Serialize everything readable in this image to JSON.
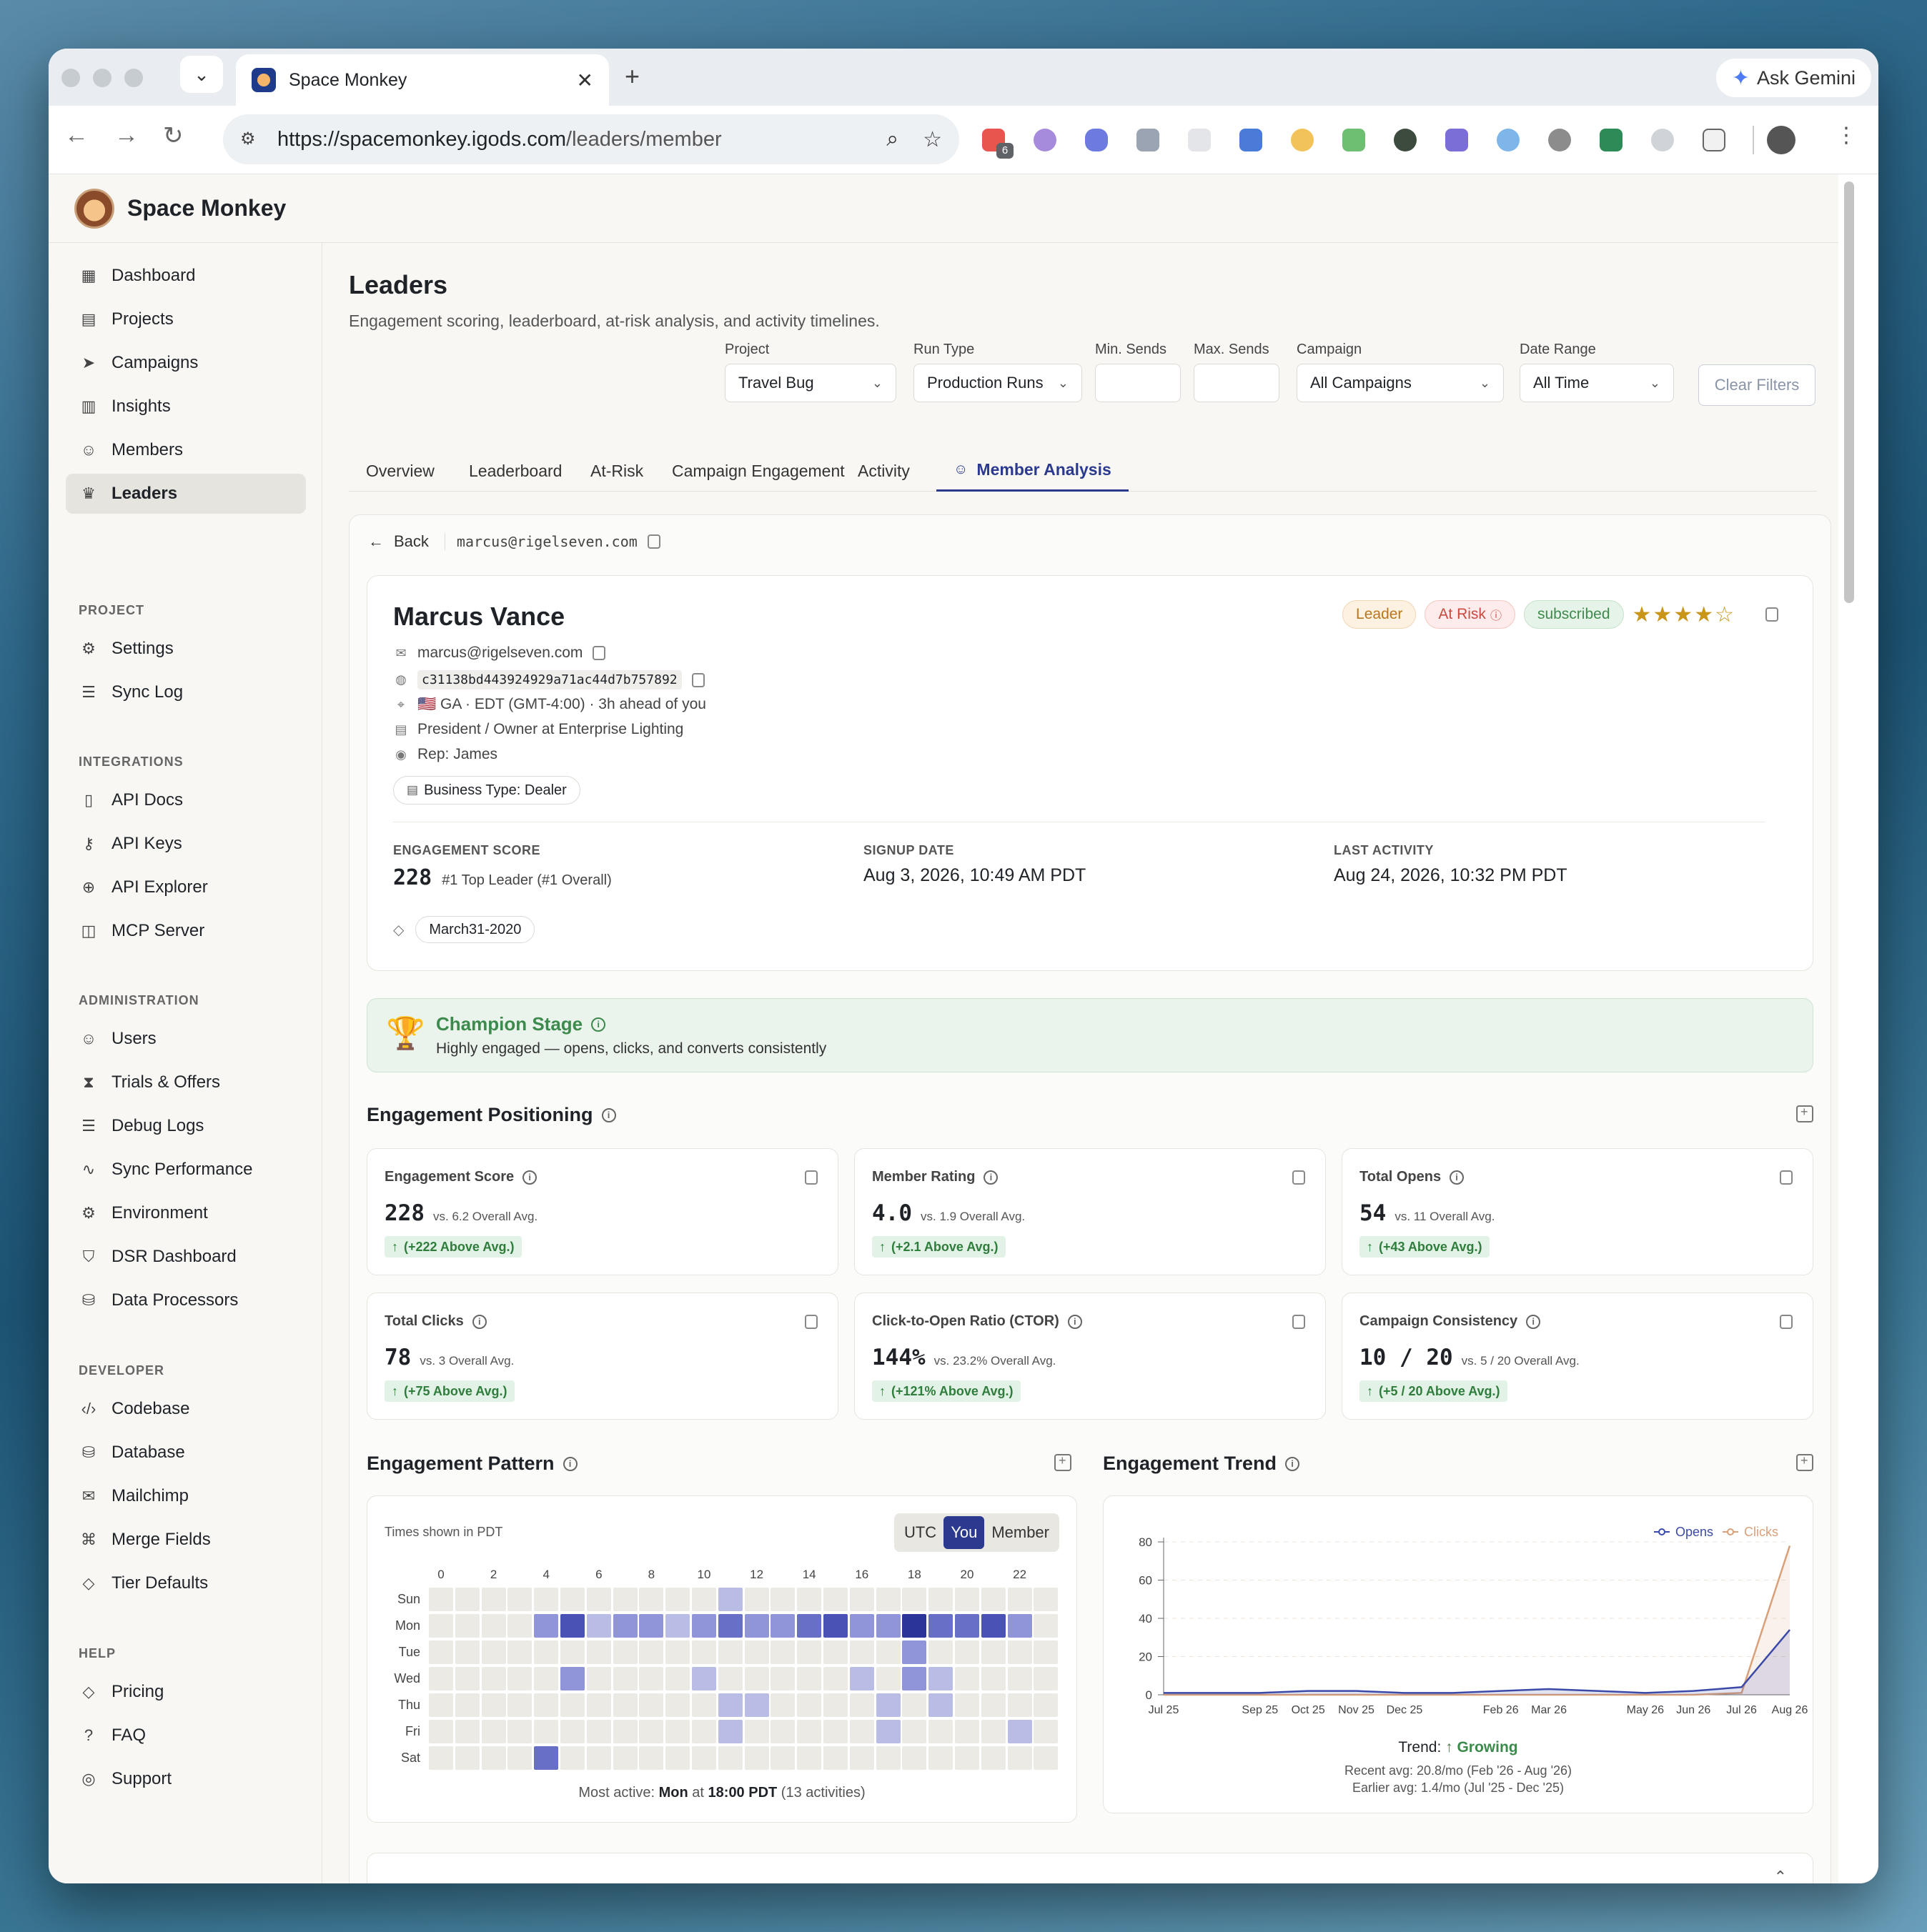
{
  "browser": {
    "tab_title": "Space Monkey",
    "url_host": "https://spacemonkey.igods.com",
    "url_path": "/leaders/member",
    "ask_gemini": "Ask Gemini",
    "ext_badge": "6"
  },
  "app": {
    "brand": "Space Monkey",
    "sidebar": {
      "main": [
        {
          "label": "Dashboard",
          "icon": "grid-icon"
        },
        {
          "label": "Projects",
          "icon": "building-icon"
        },
        {
          "label": "Campaigns",
          "icon": "send-icon"
        },
        {
          "label": "Insights",
          "icon": "bar-chart-icon"
        },
        {
          "label": "Members",
          "icon": "users-icon"
        },
        {
          "label": "Leaders",
          "icon": "crown-icon"
        }
      ],
      "project_title": "PROJECT",
      "project": [
        {
          "label": "Settings",
          "icon": "gear-icon"
        },
        {
          "label": "Sync Log",
          "icon": "log-icon"
        }
      ],
      "integrations_title": "INTEGRATIONS",
      "integrations": [
        {
          "label": "API Docs",
          "icon": "book-icon"
        },
        {
          "label": "API Keys",
          "icon": "key-icon"
        },
        {
          "label": "API Explorer",
          "icon": "globe-icon"
        },
        {
          "label": "MCP Server",
          "icon": "robot-icon"
        }
      ],
      "administration_title": "ADMINISTRATION",
      "administration": [
        {
          "label": "Users",
          "icon": "users-icon"
        },
        {
          "label": "Trials & Offers",
          "icon": "hourglass-icon"
        },
        {
          "label": "Debug Logs",
          "icon": "log-icon"
        },
        {
          "label": "Sync Performance",
          "icon": "pulse-icon"
        },
        {
          "label": "Environment",
          "icon": "gear-icon"
        },
        {
          "label": "DSR Dashboard",
          "icon": "shield-icon"
        },
        {
          "label": "Data Processors",
          "icon": "database-icon"
        }
      ],
      "developer_title": "DEVELOPER",
      "developer": [
        {
          "label": "Codebase",
          "icon": "code-icon"
        },
        {
          "label": "Database",
          "icon": "database-icon"
        },
        {
          "label": "Mailchimp",
          "icon": "mail-icon"
        },
        {
          "label": "Merge Fields",
          "icon": "tags-icon"
        },
        {
          "label": "Tier Defaults",
          "icon": "tag-icon"
        }
      ],
      "help_title": "HELP",
      "help": [
        {
          "label": "Pricing",
          "icon": "tag-icon"
        },
        {
          "label": "FAQ",
          "icon": "question-icon"
        },
        {
          "label": "Support",
          "icon": "lifebuoy-icon"
        }
      ]
    },
    "page": {
      "title": "Leaders",
      "subtitle": "Engagement scoring, leaderboard, at-risk analysis, and activity timelines.",
      "filters": {
        "project": {
          "label": "Project",
          "value": "Travel Bug"
        },
        "run_type": {
          "label": "Run Type",
          "value": "Production Runs"
        },
        "min_sends": {
          "label": "Min. Sends",
          "value": ""
        },
        "max_sends": {
          "label": "Max. Sends",
          "value": ""
        },
        "campaign": {
          "label": "Campaign",
          "value": "All Campaigns"
        },
        "date_range": {
          "label": "Date Range",
          "value": "All Time"
        },
        "clear": "Clear Filters"
      },
      "tabs": [
        "Overview",
        "Leaderboard",
        "At-Risk",
        "Campaign Engagement",
        "Activity",
        "Member Analysis"
      ],
      "active_tab": "Member Analysis"
    },
    "member": {
      "back": "Back",
      "email_mono": "marcus@rigelseven.com",
      "name": "Marcus Vance",
      "email": "marcus@rigelseven.com",
      "hash": "c31138bd443924929a71ac44d7b757892",
      "location": "🇺🇸 GA · EDT (GMT-4:00) · 3h ahead of you",
      "role": "President / Owner at Enterprise Lighting",
      "rep": "Rep: James",
      "business_type": "Business Type: Dealer",
      "badges": {
        "leader": "Leader",
        "at_risk": "At Risk",
        "subscribed": "subscribed"
      },
      "rating_stars": 4,
      "engagement_label": "ENGAGEMENT SCORE",
      "engagement_value": "228",
      "engagement_rank": "#1 Top Leader (#1 Overall)",
      "signup_label": "SIGNUP DATE",
      "signup_value": "Aug 3, 2026, 10:49 AM PDT",
      "last_label": "LAST ACTIVITY",
      "last_value": "Aug 24, 2026, 10:32 PM PDT",
      "tag": "March31-2020",
      "champion_title": "Champion Stage",
      "champion_desc": "Highly engaged — opens, clicks, and converts consistently"
    },
    "positioning": {
      "title": "Engagement Positioning",
      "cards": [
        {
          "label": "Engagement Score",
          "value": "228",
          "avg": "vs. 6.2 Overall Avg.",
          "delta": "(+222 Above Avg.)"
        },
        {
          "label": "Member Rating",
          "value": "4.0",
          "avg": "vs. 1.9 Overall Avg.",
          "delta": "(+2.1 Above Avg.)"
        },
        {
          "label": "Total Opens",
          "value": "54",
          "avg": "vs. 11 Overall Avg.",
          "delta": "(+43 Above Avg.)"
        },
        {
          "label": "Total Clicks",
          "value": "78",
          "avg": "vs. 3 Overall Avg.",
          "delta": "(+75 Above Avg.)"
        },
        {
          "label": "Click-to-Open Ratio (CTOR)",
          "value": "144%",
          "avg": "vs. 23.2% Overall Avg.",
          "delta": "(+121% Above Avg.)"
        },
        {
          "label": "Campaign Consistency",
          "value": "10 / 20",
          "avg": "vs. 5 / 20 Overall Avg.",
          "delta": "(+5 / 20 Above Avg.)"
        }
      ]
    },
    "pattern": {
      "title": "Engagement Pattern",
      "tz_note": "Times shown in PDT",
      "seg": [
        "UTC",
        "You",
        "Member"
      ],
      "seg_active": "You",
      "days": [
        "Sun",
        "Mon",
        "Tue",
        "Wed",
        "Thu",
        "Fri",
        "Sat"
      ],
      "hour_labels": [
        "0",
        "2",
        "4",
        "6",
        "8",
        "10",
        "12",
        "14",
        "16",
        "18",
        "20",
        "22"
      ],
      "intensity": [
        [
          0,
          0,
          0,
          0,
          0,
          0,
          0,
          0,
          0,
          0,
          0,
          1,
          0,
          0,
          0,
          0,
          0,
          0,
          0,
          0,
          0,
          0,
          0,
          0
        ],
        [
          0,
          0,
          0,
          0,
          2,
          4,
          1,
          2,
          2,
          1,
          2,
          3,
          2,
          2,
          3,
          4,
          2,
          2,
          5,
          3,
          3,
          4,
          2,
          0
        ],
        [
          0,
          0,
          0,
          0,
          0,
          0,
          0,
          0,
          0,
          0,
          0,
          0,
          0,
          0,
          0,
          0,
          0,
          0,
          2,
          0,
          0,
          0,
          0,
          0
        ],
        [
          0,
          0,
          0,
          0,
          0,
          2,
          0,
          0,
          0,
          0,
          1,
          0,
          0,
          0,
          0,
          0,
          1,
          0,
          2,
          1,
          0,
          0,
          0,
          0
        ],
        [
          0,
          0,
          0,
          0,
          0,
          0,
          0,
          0,
          0,
          0,
          0,
          1,
          1,
          0,
          0,
          0,
          0,
          1,
          0,
          1,
          0,
          0,
          0,
          0
        ],
        [
          0,
          0,
          0,
          0,
          0,
          0,
          0,
          0,
          0,
          0,
          0,
          1,
          0,
          0,
          0,
          0,
          0,
          1,
          0,
          0,
          0,
          0,
          1,
          0
        ],
        [
          0,
          0,
          0,
          0,
          3,
          0,
          0,
          0,
          0,
          0,
          0,
          0,
          0,
          0,
          0,
          0,
          0,
          0,
          0,
          0,
          0,
          0,
          0,
          0
        ]
      ],
      "summary_prefix": "Most active: ",
      "summary_day": "Mon",
      "summary_mid": " at ",
      "summary_time": "18:00 PDT",
      "summary_suffix": " (13 activities)"
    },
    "trend": {
      "title": "Engagement Trend",
      "trend_label": "Trend: ",
      "trend_value": "↑ Growing",
      "recent": "Recent avg: 20.8/mo (Feb '26 - Aug '26)",
      "earlier": "Earlier avg: 1.4/mo (Jul '25 - Dec '25)"
    }
  },
  "chart_data": {
    "type": "line",
    "x": [
      "Jul 25",
      "Aug 25",
      "Sep 25",
      "Oct 25",
      "Nov 25",
      "Dec 25",
      "Jan 26",
      "Feb 26",
      "Mar 26",
      "Apr 26",
      "May 26",
      "Jun 26",
      "Jul 26",
      "Aug 26"
    ],
    "tick_labels": [
      "Jul 25",
      "Sep 25",
      "Oct 25",
      "Nov 25",
      "Dec 25",
      "Feb 26",
      "Mar 26",
      "May 26",
      "Jun 26",
      "Jul 26",
      "Aug 26"
    ],
    "series": [
      {
        "name": "Opens",
        "color": "#3b4aa8",
        "values": [
          1,
          1,
          1,
          2,
          2,
          1,
          1,
          2,
          3,
          2,
          1,
          2,
          4,
          34
        ]
      },
      {
        "name": "Clicks",
        "color": "#d9a079",
        "values": [
          0,
          0,
          0,
          0,
          0,
          0,
          0,
          0,
          0,
          0,
          0,
          0,
          1,
          78
        ]
      }
    ],
    "ylim": [
      0,
      80
    ],
    "yticks": [
      0,
      20,
      40,
      60,
      80
    ],
    "grid": true,
    "legend": "top-right"
  }
}
